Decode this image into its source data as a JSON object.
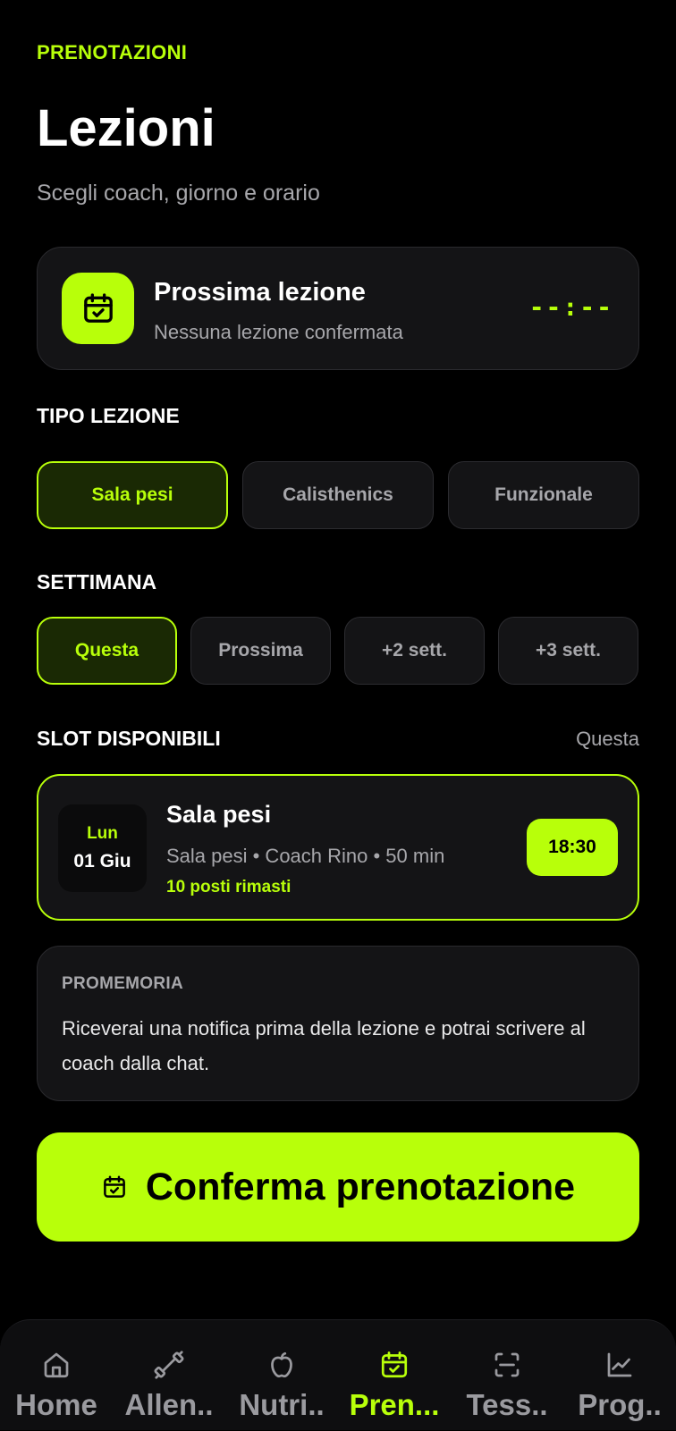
{
  "header": {
    "eyebrow": "PRENOTAZIONI",
    "title": "Lezioni",
    "subtitle": "Scegli coach, giorno e orario"
  },
  "next_lesson": {
    "title": "Prossima lezione",
    "subtitle": "Nessuna lezione confermata",
    "time": "--:--",
    "icon": "calendar-check-icon"
  },
  "lesson_type": {
    "label": "TIPO LEZIONE",
    "options": [
      "Sala pesi",
      "Calisthenics",
      "Funzionale"
    ],
    "selected": "Sala pesi"
  },
  "week": {
    "label": "SETTIMANA",
    "options": [
      "Questa",
      "Prossima",
      "+2 sett.",
      "+3 sett."
    ],
    "selected": "Questa"
  },
  "slots": {
    "label": "SLOT DISPONIBILI",
    "filter": "Questa",
    "items": [
      {
        "day": "Lun",
        "date": "01 Giu",
        "name": "Sala pesi",
        "meta": "Sala pesi • Coach Rino • 50 min",
        "spots": "10 posti rimasti",
        "time": "18:30"
      }
    ]
  },
  "reminder": {
    "label": "PROMEMORIA",
    "text": "Riceverai una notifica prima della lezione e potrai scrivere al coach dalla chat."
  },
  "cta": {
    "label": "Conferma prenotazione",
    "icon": "calendar-check-icon"
  },
  "tabbar": {
    "items": [
      {
        "label": "Home",
        "icon": "home-icon"
      },
      {
        "label": "Allen..",
        "icon": "dumbbell-icon"
      },
      {
        "label": "Nutri..",
        "icon": "apple-icon"
      },
      {
        "label": "Pren...",
        "icon": "calendar-check-icon"
      },
      {
        "label": "Tess..",
        "icon": "scan-icon"
      },
      {
        "label": "Prog..",
        "icon": "chart-line-icon"
      }
    ],
    "active": "Pren..."
  },
  "colors": {
    "accent": "#b8ff0a",
    "background": "#000000",
    "card": "#141416",
    "muted": "#a7a7ab"
  }
}
